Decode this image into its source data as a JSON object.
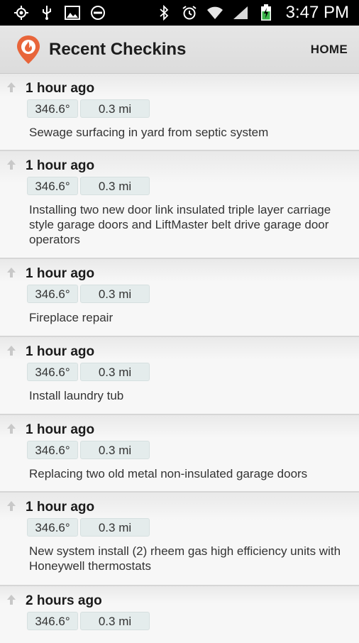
{
  "status_bar": {
    "time": "3:47 PM",
    "left_icons": [
      "gps-icon",
      "usb-icon",
      "image-icon",
      "do-not-disturb-icon"
    ],
    "right_icons": [
      "bluetooth-icon",
      "alarm-icon",
      "wifi-icon",
      "signal-icon",
      "battery-charging-icon"
    ]
  },
  "header": {
    "title": "Recent Checkins",
    "home_label": "HOME",
    "logo_color": "#e8653a"
  },
  "checkins": [
    {
      "time": "1 hour ago",
      "heading": "346.6°",
      "distance": "0.3 mi",
      "description": "Sewage surfacing in yard from septic system"
    },
    {
      "time": "1 hour ago",
      "heading": "346.6°",
      "distance": "0.3 mi",
      "description": "Installing two new door link insulated triple layer carriage style garage doors and LiftMaster belt drive garage door operators"
    },
    {
      "time": "1 hour ago",
      "heading": "346.6°",
      "distance": "0.3 mi",
      "description": "Fireplace repair"
    },
    {
      "time": "1 hour ago",
      "heading": "346.6°",
      "distance": "0.3 mi",
      "description": "Install laundry tub"
    },
    {
      "time": "1 hour ago",
      "heading": "346.6°",
      "distance": "0.3 mi",
      "description": "Replacing two old metal non-insulated garage doors"
    },
    {
      "time": "1 hour ago",
      "heading": "346.6°",
      "distance": "0.3 mi",
      "description": "New system install (2) rheem gas high efficiency units with Honeywell thermostats"
    },
    {
      "time": "2 hours ago",
      "heading": "346.6°",
      "distance": "0.3 mi",
      "description": ""
    }
  ]
}
